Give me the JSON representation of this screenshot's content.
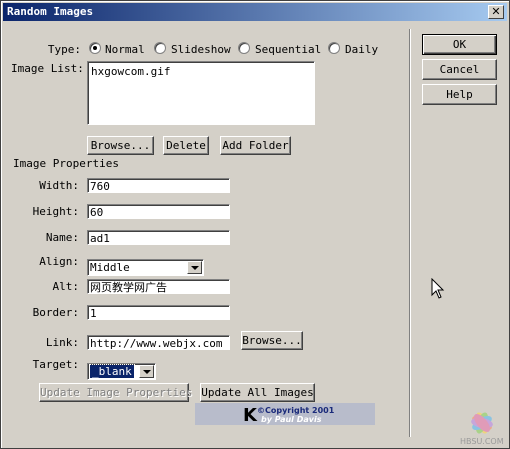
{
  "window": {
    "title": "Random Images",
    "close_glyph": "✕"
  },
  "type": {
    "label": "Type:",
    "options": [
      "Normal",
      "Slideshow",
      "Sequential",
      "Daily"
    ],
    "selected": "Normal"
  },
  "image_list": {
    "label": "Image List:",
    "items": [
      "hxgowcom.gif"
    ]
  },
  "list_buttons": {
    "browse": "Browse...",
    "delete": "Delete",
    "add_folder": "Add Folder"
  },
  "properties": {
    "heading": "Image Properties",
    "width_label": "Width:",
    "width_value": "760",
    "height_label": "Height:",
    "height_value": "60",
    "name_label": "Name:",
    "name_value": "ad1",
    "align_label": "Align:",
    "align_value": "Middle",
    "alt_label": "Alt:",
    "alt_value": "网页教学网广告",
    "border_label": "Border:",
    "border_value": "1",
    "link_label": "Link:",
    "link_value": "http://www.webjx.com",
    "link_browse": "Browse...",
    "target_label": "Target:",
    "target_value": "_blank"
  },
  "actions": {
    "update_image": "Update Image Properties",
    "update_all": "Update All Images"
  },
  "dialog_buttons": {
    "ok": "OK",
    "cancel": "Cancel",
    "help": "Help"
  },
  "credit": {
    "logo_letter": "K",
    "copyright": "©Copyright 2001",
    "author": "by Paul Davis"
  },
  "watermark": {
    "text": "HBSU.COM"
  }
}
